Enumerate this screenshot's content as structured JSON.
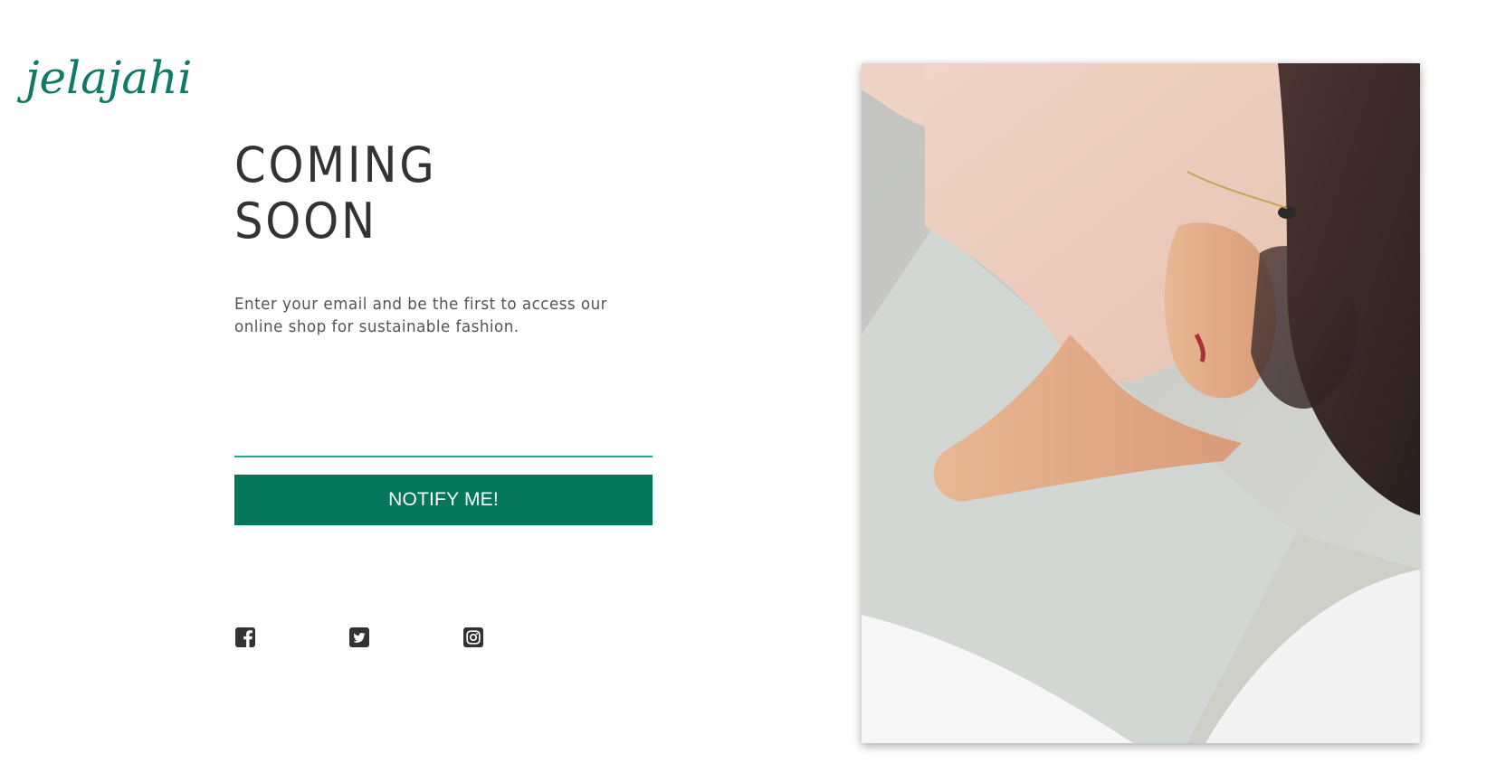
{
  "brand": {
    "logo_text": "jelajahi",
    "logo_color": "#0f7a66"
  },
  "hero": {
    "headline_line1": "COMING",
    "headline_line2": "SOON",
    "subtitle": "Enter your email and be the first to access our online shop for sustainable fashion."
  },
  "signup": {
    "email_value": "",
    "email_placeholder": "",
    "button_label": "NOTIFY ME!",
    "button_color": "#03765c",
    "underline_color": "#1fa88d"
  },
  "social": [
    {
      "icon": "facebook-icon"
    },
    {
      "icon": "twitter-icon"
    },
    {
      "icon": "instagram-icon"
    }
  ],
  "image": {
    "alt": "Woman in a pale pink top lying on a bed"
  }
}
